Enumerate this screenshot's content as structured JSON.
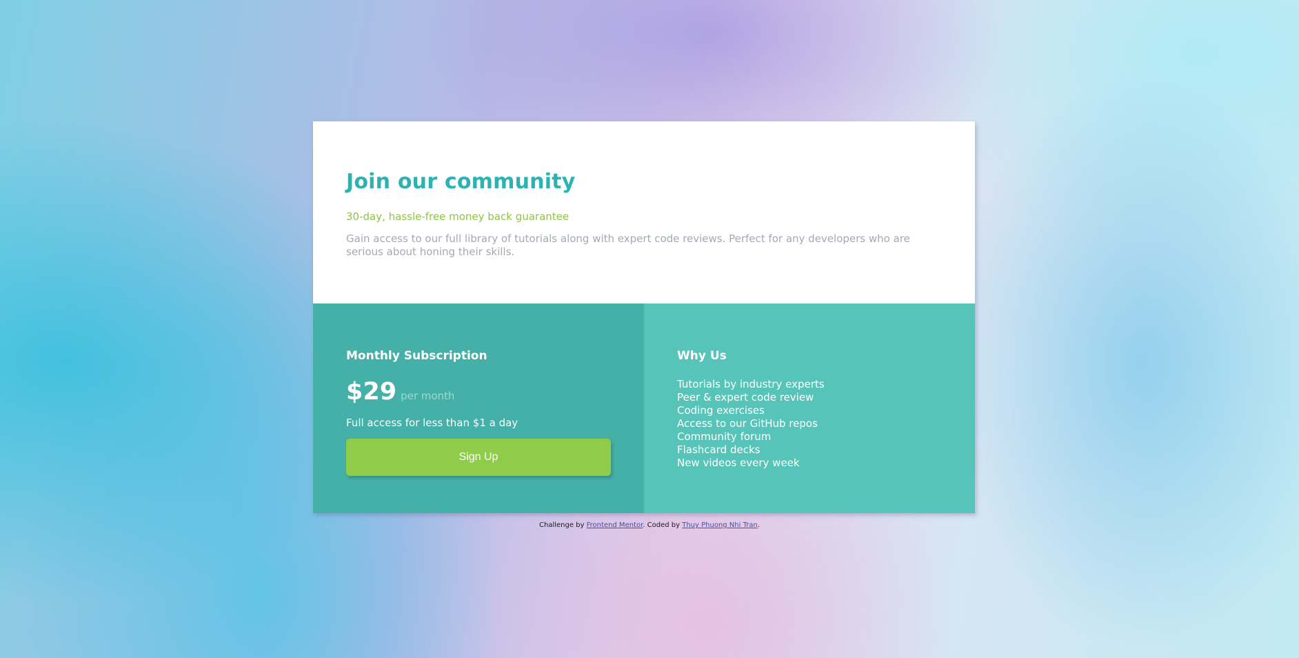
{
  "card": {
    "title": "Join our community",
    "guarantee": "30-day, hassle-free money back guarantee",
    "description": "Gain access to our full library of tutorials along with expert code reviews. Perfect for any developers who are serious about honing their skills."
  },
  "subscription": {
    "title": "Monthly Subscription",
    "price": "$29",
    "period": "per month",
    "access_note": "Full access for less than $1 a day",
    "signup_label": "Sign Up"
  },
  "why_us": {
    "title": "Why Us",
    "items": [
      "Tutorials by industry experts",
      "Peer & expert code review",
      "Coding exercises",
      "Access to our GitHub repos",
      "Community forum",
      "Flashcard decks",
      "New videos every week"
    ]
  },
  "attribution": {
    "challenge_prefix": "Challenge by ",
    "challenge_link": "Frontend Mentor",
    "coded_prefix": ". Coded by ",
    "coded_link": "Thuy Phuong Nhi Tran",
    "suffix": "."
  },
  "colors": {
    "title_teal": "#2bb3b1",
    "guarantee_green": "#8cc63f",
    "left_panel": "#44b0a7",
    "right_panel": "#57c4b9",
    "button_green": "#8fcc4a"
  }
}
